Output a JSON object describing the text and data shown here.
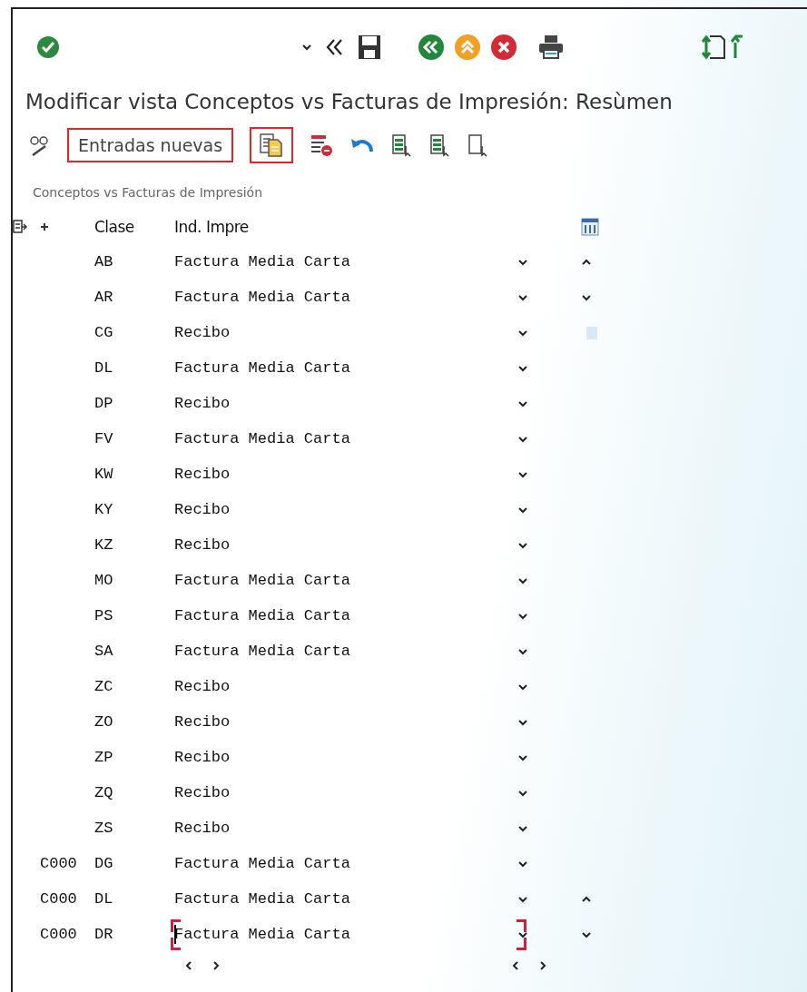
{
  "window": {
    "title": "Modificar vista Conceptos vs Facturas de Impresión: Resùmen"
  },
  "action_bar": {
    "new_entries": {
      "label": "Entradas nuevas",
      "highlighted": true
    },
    "copy": {
      "highlighted": true
    }
  },
  "table": {
    "title": "Conceptos vs Facturas de Impresión",
    "columns": [
      "Clase",
      "Ind. Impre"
    ],
    "rows": [
      {
        "clase": "AB",
        "ind": "Factura Media Carta",
        "focused": false
      },
      {
        "clase": "AR",
        "ind": "Factura Media Carta",
        "focused": false
      },
      {
        "clase": "CG",
        "ind": "Recibo",
        "focused": false
      },
      {
        "clase": "DL",
        "ind": "Factura Media Carta",
        "focused": false
      },
      {
        "clase": "DP",
        "ind": "Recibo",
        "focused": false
      },
      {
        "clase": "FV",
        "ind": "Factura Media Carta",
        "focused": false
      },
      {
        "clase": "KW",
        "ind": "Recibo",
        "focused": false
      },
      {
        "clase": "KY",
        "ind": "Recibo",
        "focused": false
      },
      {
        "clase": "KZ",
        "ind": "Recibo",
        "focused": false
      },
      {
        "clase": "MO",
        "ind": "Factura Media Carta",
        "focused": false
      },
      {
        "clase": "PS",
        "ind": "Factura Media Carta",
        "focused": false
      },
      {
        "clase": "SA",
        "ind": "Factura Media Carta",
        "focused": false
      },
      {
        "clase": "ZC",
        "ind": "Recibo",
        "focused": false
      },
      {
        "clase": "ZO",
        "ind": "Recibo",
        "focused": false
      },
      {
        "clase": "ZP",
        "ind": "Recibo",
        "focused": false
      },
      {
        "clase": "ZQ",
        "ind": "Recibo",
        "focused": false
      },
      {
        "clase": "ZS",
        "ind": "Recibo",
        "focused": false
      },
      {
        "concept": "C000",
        "clase": "DG",
        "ind": "Factura Media Carta",
        "focused": false
      },
      {
        "concept": "C000",
        "clase": "DL",
        "ind": "Factura Media Carta",
        "focused": false
      },
      {
        "concept": "C000",
        "clase": "DR",
        "ind": "Factura Media Carta",
        "focused": true
      }
    ]
  }
}
